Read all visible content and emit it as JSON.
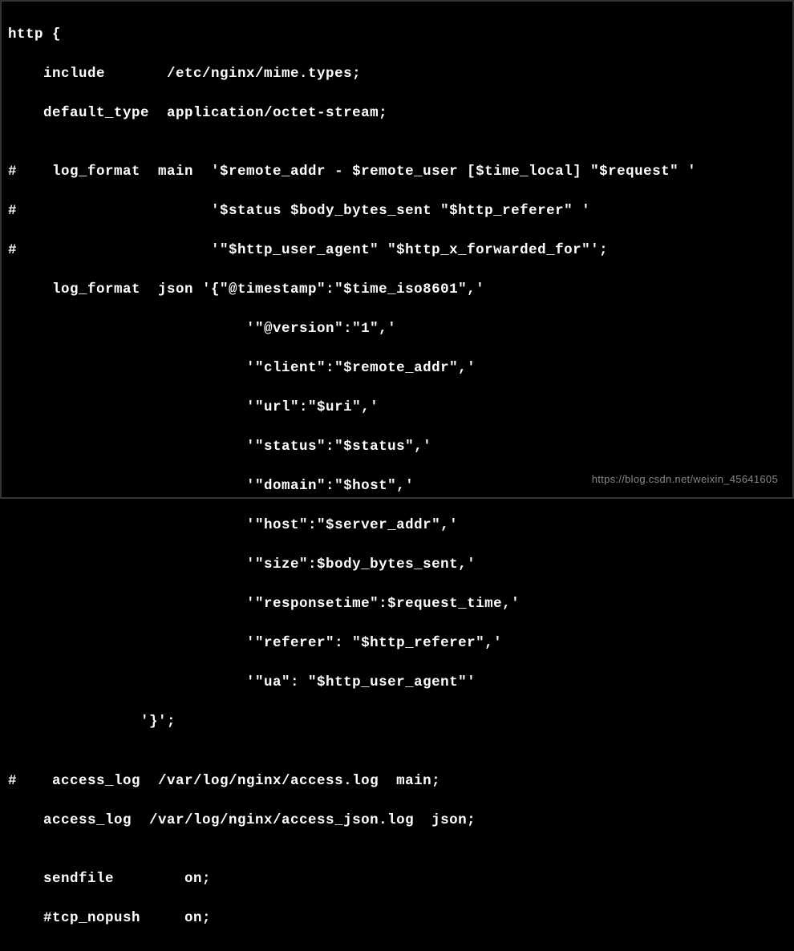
{
  "code": {
    "lines": [
      "http {",
      "    include       /etc/nginx/mime.types;",
      "    default_type  application/octet-stream;",
      "",
      "#    log_format  main  '$remote_addr - $remote_user [$time_local] \"$request\" '",
      "#                      '$status $body_bytes_sent \"$http_referer\" '",
      "#                      '\"$http_user_agent\" \"$http_x_forwarded_for\"';",
      "     log_format  json '{\"@timestamp\":\"$time_iso8601\",'",
      "                           '\"@version\":\"1\",'",
      "                           '\"client\":\"$remote_addr\",'",
      "                           '\"url\":\"$uri\",'",
      "                           '\"status\":\"$status\",'",
      "                           '\"domain\":\"$host\",'",
      "                           '\"host\":\"$server_addr\",'",
      "                           '\"size\":$body_bytes_sent,'",
      "                           '\"responsetime\":$request_time,'",
      "                           '\"referer\": \"$http_referer\",'",
      "                           '\"ua\": \"$http_user_agent\"'",
      "               '}';",
      "",
      "#    access_log  /var/log/nginx/access.log  main;",
      "    access_log  /var/log/nginx/access_json.log  json;",
      "",
      "    sendfile        on;",
      "    #tcp_nopush     on;"
    ]
  },
  "watermark": "https://blog.csdn.net/weixin_45641605"
}
